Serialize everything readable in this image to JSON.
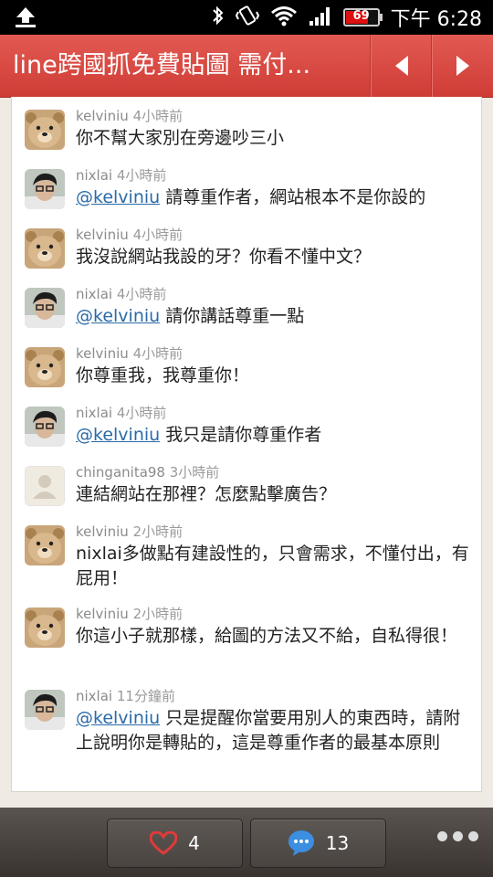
{
  "status_bar": {
    "battery_level": "69",
    "time": "下午 6:28"
  },
  "header": {
    "title": "line跨國抓免費貼圖 需付...",
    "prev_icon": "chevron-left-icon",
    "next_icon": "chevron-right-icon"
  },
  "comments": [
    {
      "user": "kelviniu",
      "time": "4小時前",
      "avatar": "teddy-bear",
      "mention": "",
      "text": "你不幫大家別在旁邊吵三小"
    },
    {
      "user": "nixlai",
      "time": "4小時前",
      "avatar": "person",
      "mention": "@kelviniu",
      "text": " 請尊重作者，網站根本不是你設的"
    },
    {
      "user": "kelviniu",
      "time": "4小時前",
      "avatar": "teddy-bear",
      "mention": "",
      "text": "我沒說網站我設的牙？你看不懂中文？"
    },
    {
      "user": "nixlai",
      "time": "4小時前",
      "avatar": "person",
      "mention": "@kelviniu",
      "text": " 請你講話尊重一點"
    },
    {
      "user": "kelviniu",
      "time": "4小時前",
      "avatar": "teddy-bear",
      "mention": "",
      "text": "你尊重我，我尊重你！"
    },
    {
      "user": "nixlai",
      "time": "4小時前",
      "avatar": "person",
      "mention": "@kelviniu",
      "text": " 我只是請你尊重作者"
    },
    {
      "user": "chinganita98",
      "time": "3小時前",
      "avatar": "default",
      "mention": "",
      "text": "連結網站在那裡？怎麼點擊廣告？"
    },
    {
      "user": "kelviniu",
      "time": "2小時前",
      "avatar": "teddy-bear",
      "mention": "",
      "text": "nixlai多做點有建設性的，只會需求，不懂付出，有屁用！"
    },
    {
      "user": "kelviniu",
      "time": "2小時前",
      "avatar": "teddy-bear",
      "mention": "",
      "text": "你這小子就那樣，給圖的方法又不給，自私得很！"
    },
    {
      "user": "nixlai",
      "time": "11分鐘前",
      "avatar": "person",
      "mention": "@kelviniu",
      "text": " 只是提醒你當要用別人的東西時，請附上說明你是轉貼的，這是尊重作者的最基本原則"
    }
  ],
  "bottom_bar": {
    "like_count": "4",
    "comment_count": "13",
    "like_icon": "heart-icon",
    "comment_icon": "speech-bubble-icon",
    "more_icon": "more-icon",
    "like_color": "#e23a3a",
    "comment_color": "#3b8ee0"
  }
}
